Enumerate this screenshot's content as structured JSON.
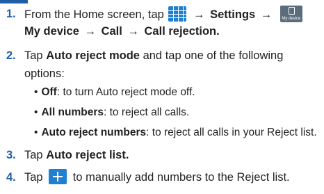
{
  "steps": [
    {
      "number": "1.",
      "lines": {
        "l1_prefix": "From the Home screen, tap",
        "l1_arrow1": "→",
        "l1_settings": "Settings",
        "l1_arrow2": "→",
        "l1_icon_caption": "My device",
        "l2_mydevice": "My device",
        "l2_arrow1": "→",
        "l2_call": "Call",
        "l2_arrow2": "→",
        "l2_rejection": "Call rejection",
        "l2_period": "."
      }
    },
    {
      "number": "2.",
      "lines": {
        "l1_prefix": "Tap",
        "l1_bold": "Auto reject mode",
        "l1_suffix": "and tap one of the following",
        "l2": "options:"
      }
    },
    {
      "number": "3.",
      "lines": {
        "prefix": "Tap",
        "bold": "Auto reject list",
        "period": "."
      }
    },
    {
      "number": "4.",
      "lines": {
        "prefix": "Tap",
        "suffix": "to manually add numbers to the Reject list."
      }
    }
  ],
  "bullets": [
    {
      "dot": "•",
      "bold": "Off",
      "text": ": to turn Auto reject mode off."
    },
    {
      "dot": "•",
      "bold": "All numbers",
      "text": ": to reject all calls."
    },
    {
      "dot": "•",
      "bold": "Auto reject numbers",
      "text": ": to reject all calls in your Reject list."
    }
  ],
  "icons": {
    "apps": "apps-grid-icon",
    "my_device": "my-device-icon",
    "add": "plus-icon"
  },
  "colors": {
    "accent": "#1f5fa8",
    "icon_blue": "#1f7fd0",
    "text": "#231f20"
  }
}
